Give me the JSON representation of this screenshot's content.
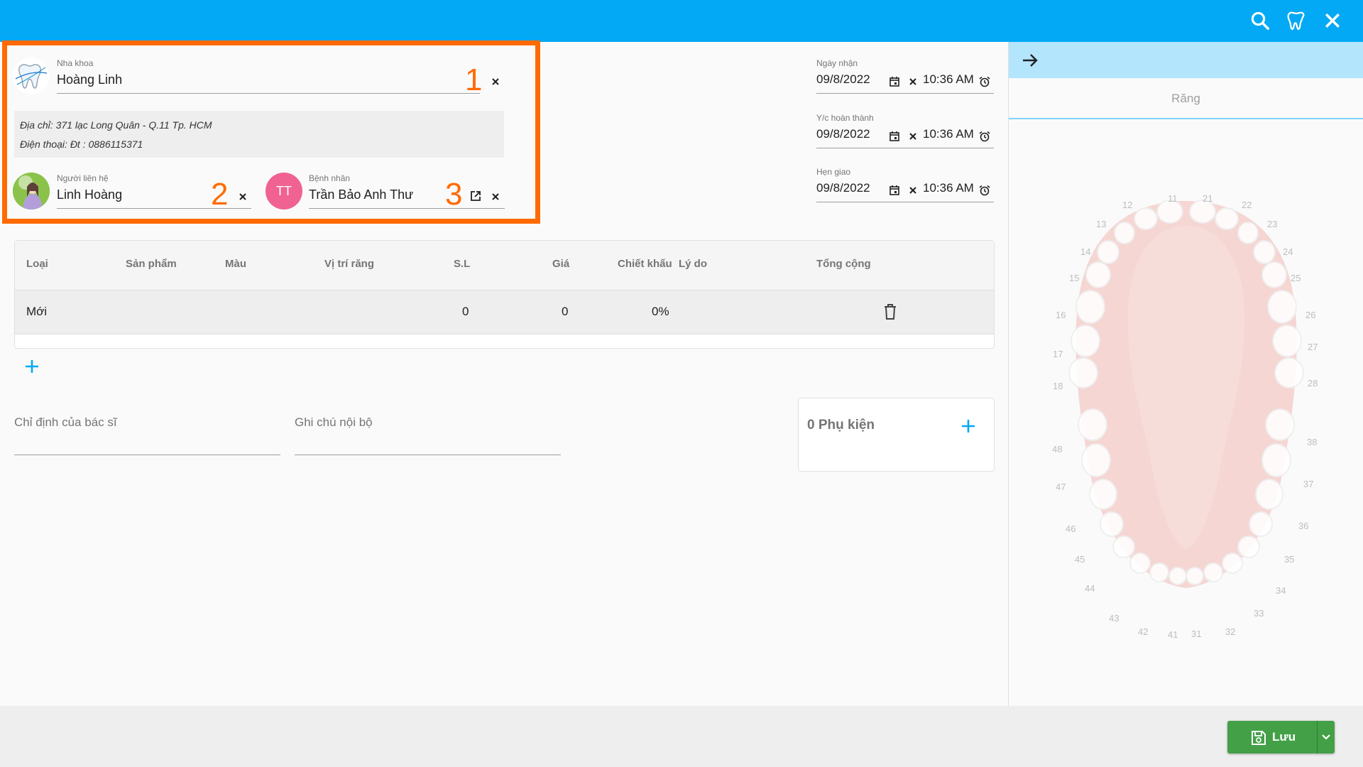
{
  "topbar": {
    "icons": [
      "search-icon",
      "tooth-icon",
      "close-icon"
    ]
  },
  "clinic": {
    "label": "Nha khoa",
    "value": "Hoàng Linh",
    "address": "Địa chỉ: 371 lạc Long Quân - Q.11 Tp. HCM",
    "phone": "Điện thoại: Đt : 0886115371"
  },
  "contact": {
    "label": "Người liên hệ",
    "value": "Linh Hoàng"
  },
  "patient": {
    "label": "Bệnh nhân",
    "value": "Trần Bảo Anh Thư",
    "initials": "TT"
  },
  "annotations": [
    "1",
    "2",
    "3"
  ],
  "dates": [
    {
      "label": "Ngày nhận",
      "date": "09/8/2022",
      "time": "10:36 AM"
    },
    {
      "label": "Y/c hoàn thành",
      "date": "09/8/2022",
      "time": "10:36 AM"
    },
    {
      "label": "Hẹn giao",
      "date": "09/8/2022",
      "time": "10:36 AM"
    }
  ],
  "table": {
    "headers": [
      "Loại",
      "Sản phẩm",
      "Màu",
      "Vị trí răng",
      "S.L",
      "Giá",
      "Chiết khấu",
      "Lý do",
      "Tổng cộng"
    ],
    "row": {
      "loai": "Mới",
      "sl": "0",
      "gia": "0",
      "chiet_khau": "0%"
    }
  },
  "fields": {
    "doctor_instruction": "Chỉ định của bác sĩ",
    "internal_note": "Ghi chú nội bộ"
  },
  "accessories": {
    "label": "0 Phụ kiện"
  },
  "right_panel": {
    "tab": "Răng",
    "tooth_numbers": [
      "11",
      "12",
      "13",
      "14",
      "15",
      "16",
      "17",
      "18",
      "21",
      "22",
      "23",
      "24",
      "25",
      "26",
      "27",
      "28",
      "31",
      "32",
      "33",
      "34",
      "35",
      "36",
      "37",
      "38",
      "41",
      "42",
      "43",
      "44",
      "45",
      "46",
      "47",
      "48"
    ]
  },
  "footer": {
    "save_label": "Lưu"
  },
  "colors": {
    "primary": "#03a9f4",
    "highlight": "#ff6a00",
    "save": "#43a047",
    "avatar_patient": "#f06292"
  }
}
